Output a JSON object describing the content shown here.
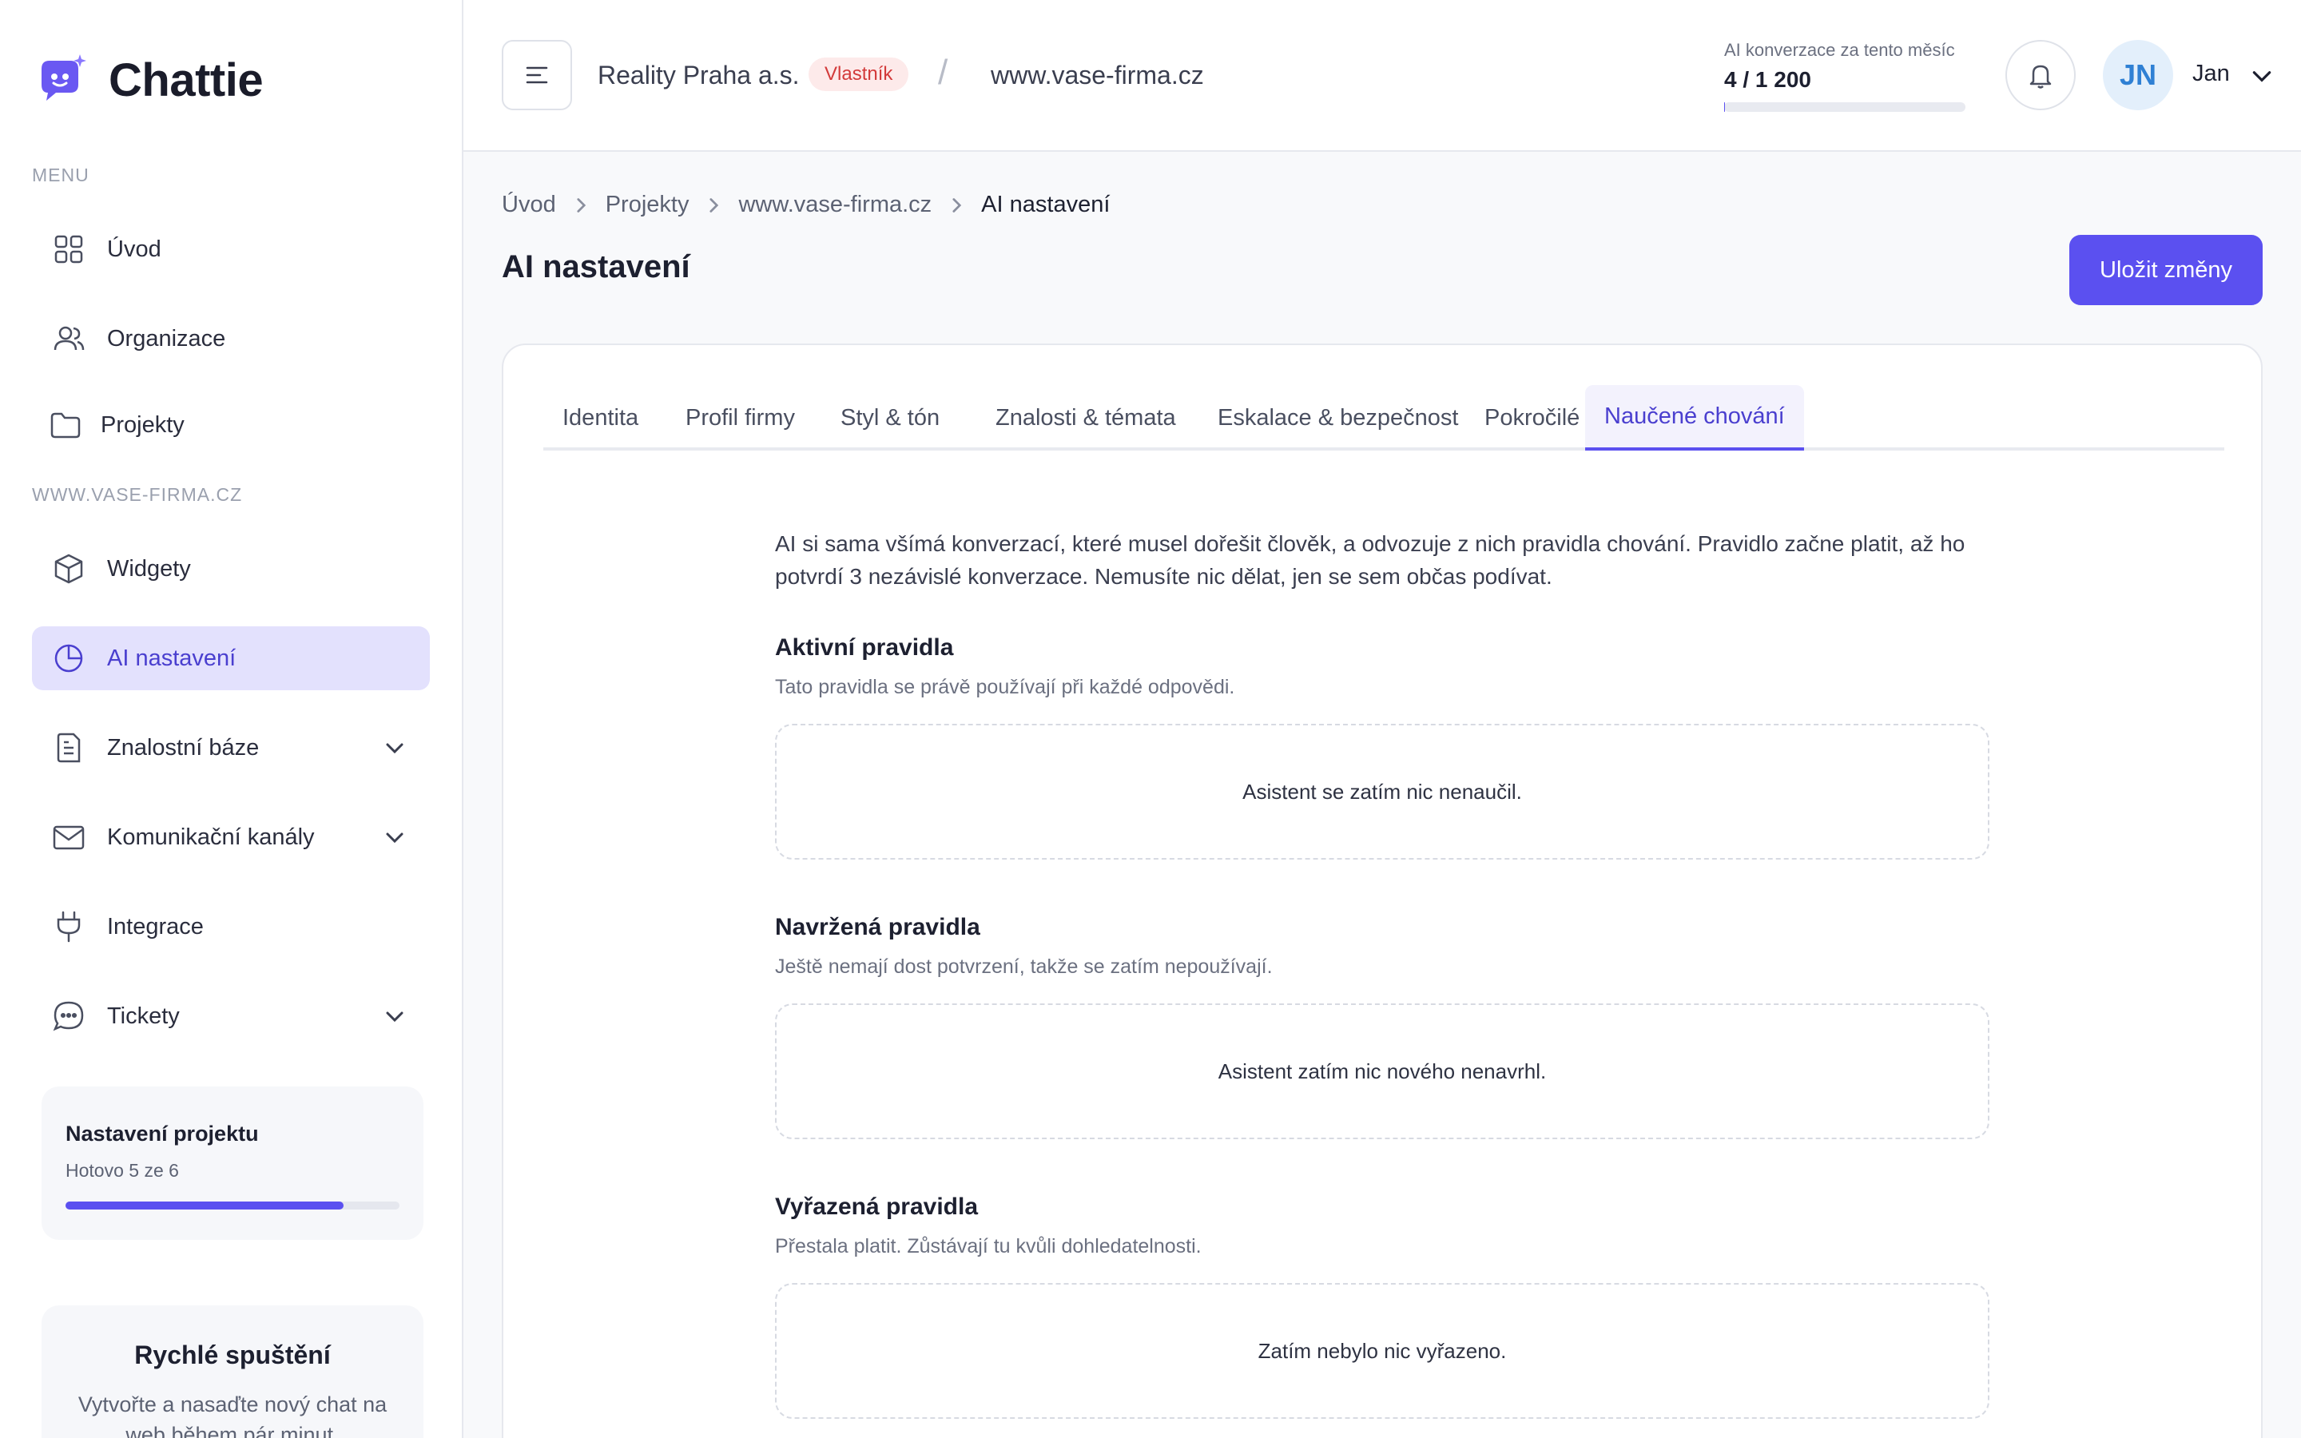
{
  "brand": {
    "name": "Chattie"
  },
  "sidebar": {
    "menu_label": "MENU",
    "project_label": "WWW.VASE-FIRMA.CZ",
    "menu_items": [
      {
        "label": "Úvod",
        "icon": "grid-icon"
      },
      {
        "label": "Organizace",
        "icon": "users-icon"
      },
      {
        "label": "Projekty",
        "icon": "folder-icon"
      }
    ],
    "project_items": [
      {
        "label": "Widgety",
        "icon": "cube-icon"
      },
      {
        "label": "AI nastavení",
        "icon": "pie-chart-icon",
        "active": true
      },
      {
        "label": "Znalostní báze",
        "icon": "document-icon",
        "expandable": true
      },
      {
        "label": "Komunikační kanály",
        "icon": "mail-icon",
        "expandable": true
      },
      {
        "label": "Integrace",
        "icon": "plug-icon"
      },
      {
        "label": "Tickety",
        "icon": "chat-bubble-icon",
        "expandable": true
      }
    ],
    "setup_card": {
      "title": "Nastavení projektu",
      "subtitle": "Hotovo 5 ze 6",
      "progress": 0.833
    },
    "quick_start": {
      "title": "Rychlé spuštění",
      "text": "Vytvořte a nasaďte nový chat na web během pár minut."
    }
  },
  "header": {
    "org_name": "Reality Praha a.s.",
    "role_badge": "Vlastník",
    "separator": "/",
    "site": "www.vase-firma.cz",
    "conversations": {
      "label": "AI konverzace za tento měsíc",
      "value": "4 / 1 200",
      "used": 4,
      "limit": 1200
    },
    "avatar_initials": "JN",
    "user_name": "Jan"
  },
  "breadcrumb": [
    "Úvod",
    "Projekty",
    "www.vase-firma.cz",
    "AI nastavení"
  ],
  "page": {
    "title": "AI nastavení",
    "save_label": "Uložit změny"
  },
  "tabs": [
    {
      "label": "Identita"
    },
    {
      "label": "Profil firmy"
    },
    {
      "label": "Styl & tón"
    },
    {
      "label": "Znalosti & témata"
    },
    {
      "label": "Eskalace & bezpečnost"
    },
    {
      "label": "Pokročilé"
    },
    {
      "label": "Naučené chování",
      "active": true
    }
  ],
  "learned": {
    "intro": "AI si sama všímá konverzací, které musel dořešit člověk, a odvozuje z nich pravidla chování. Pravidlo začne platit, až ho potvrdí 3 nezávislé konverzace. Nemusíte nic dělat, jen se sem občas podívat.",
    "sections": [
      {
        "title": "Aktivní pravidla",
        "subtitle": "Tato pravidla se právě používají při každé odpovědi.",
        "empty": "Asistent se zatím nic nenaučil."
      },
      {
        "title": "Navržená pravidla",
        "subtitle": "Ještě nemají dost potvrzení, takže se zatím nepoužívají.",
        "empty": "Asistent zatím nic nového nenavrhl."
      },
      {
        "title": "Vyřazená pravidla",
        "subtitle": "Přestala platit. Zůstávají tu kvůli dohledatelnosti.",
        "empty": "Zatím nebylo nic vyřazeno."
      }
    ]
  },
  "colors": {
    "accent": "#5b50f0",
    "active_bg": "#e3e1fd",
    "badge_text": "#d33a3a",
    "badge_bg": "#fdeaea",
    "avatar_text": "#2f80d4"
  }
}
